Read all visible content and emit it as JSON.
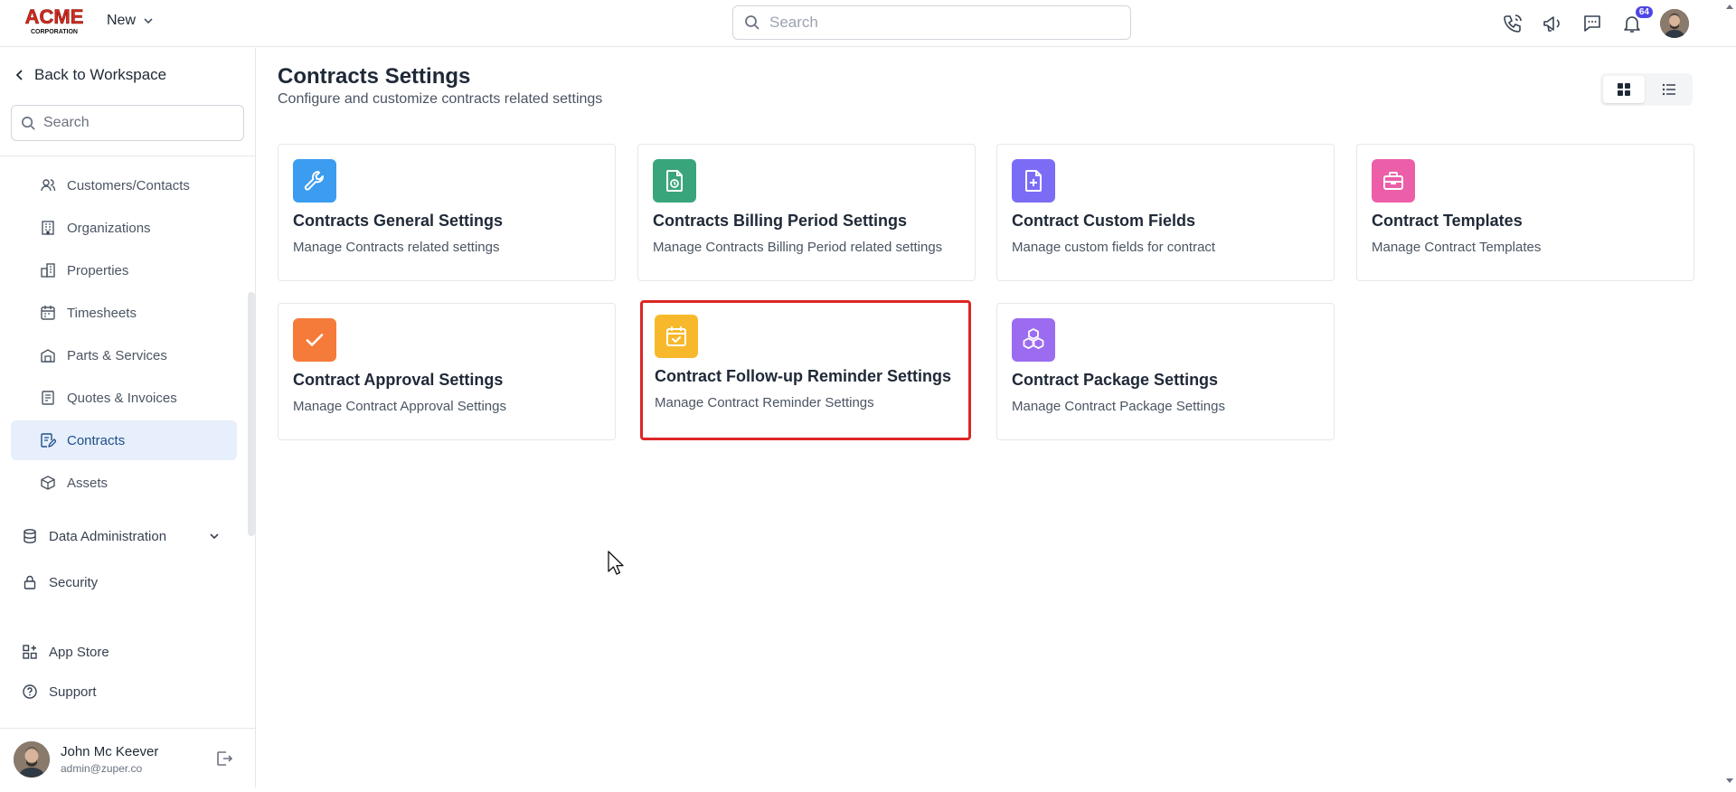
{
  "header": {
    "logo_alt": "ACME CORPORATION",
    "new_label": "New",
    "search_placeholder": "Search",
    "notification_count": "64"
  },
  "sidebar": {
    "back_label": "Back to Workspace",
    "search_placeholder": "Search",
    "items": [
      {
        "label": "Customers/Contacts",
        "icon": "users-icon"
      },
      {
        "label": "Organizations",
        "icon": "building-icon"
      },
      {
        "label": "Properties",
        "icon": "property-icon"
      },
      {
        "label": "Timesheets",
        "icon": "calendar-icon"
      },
      {
        "label": "Parts & Services",
        "icon": "warehouse-icon"
      },
      {
        "label": "Quotes & Invoices",
        "icon": "invoice-icon"
      },
      {
        "label": "Contracts",
        "icon": "contract-icon",
        "active": true
      },
      {
        "label": "Assets",
        "icon": "box-icon"
      }
    ],
    "data_admin_label": "Data Administration",
    "security_label": "Security",
    "app_store_label": "App Store",
    "support_label": "Support",
    "user": {
      "name": "John Mc Keever",
      "email": "admin@zuper.co"
    }
  },
  "main": {
    "title": "Contracts Settings",
    "subtitle": "Configure and customize contracts related settings",
    "cards": [
      {
        "title": "Contracts General Settings",
        "desc": "Manage Contracts related settings",
        "color": "#3b9cf0",
        "icon": "wrench-icon"
      },
      {
        "title": "Contracts Billing Period Settings",
        "desc": "Manage Contracts Billing Period related settings",
        "color": "#3aa57a",
        "icon": "billing-doc-icon"
      },
      {
        "title": "Contract Custom Fields",
        "desc": "Manage custom fields for contract",
        "color": "#7b6cf6",
        "icon": "file-plus-icon"
      },
      {
        "title": "Contract Templates",
        "desc": "Manage Contract Templates",
        "color": "#ec5fa8",
        "icon": "briefcase-icon"
      },
      {
        "title": "Contract Approval Settings",
        "desc": "Manage Contract Approval Settings",
        "color": "#f57b3b",
        "icon": "check-icon"
      },
      {
        "title": "Contract Follow-up Reminder Settings",
        "desc": "Manage Contract Reminder Settings",
        "color": "#f7b92b",
        "icon": "calendar-check-icon"
      },
      {
        "title": "Contract Package Settings",
        "desc": "Manage Contract Package Settings",
        "color": "#9b6cf0",
        "icon": "cubes-icon"
      }
    ]
  }
}
